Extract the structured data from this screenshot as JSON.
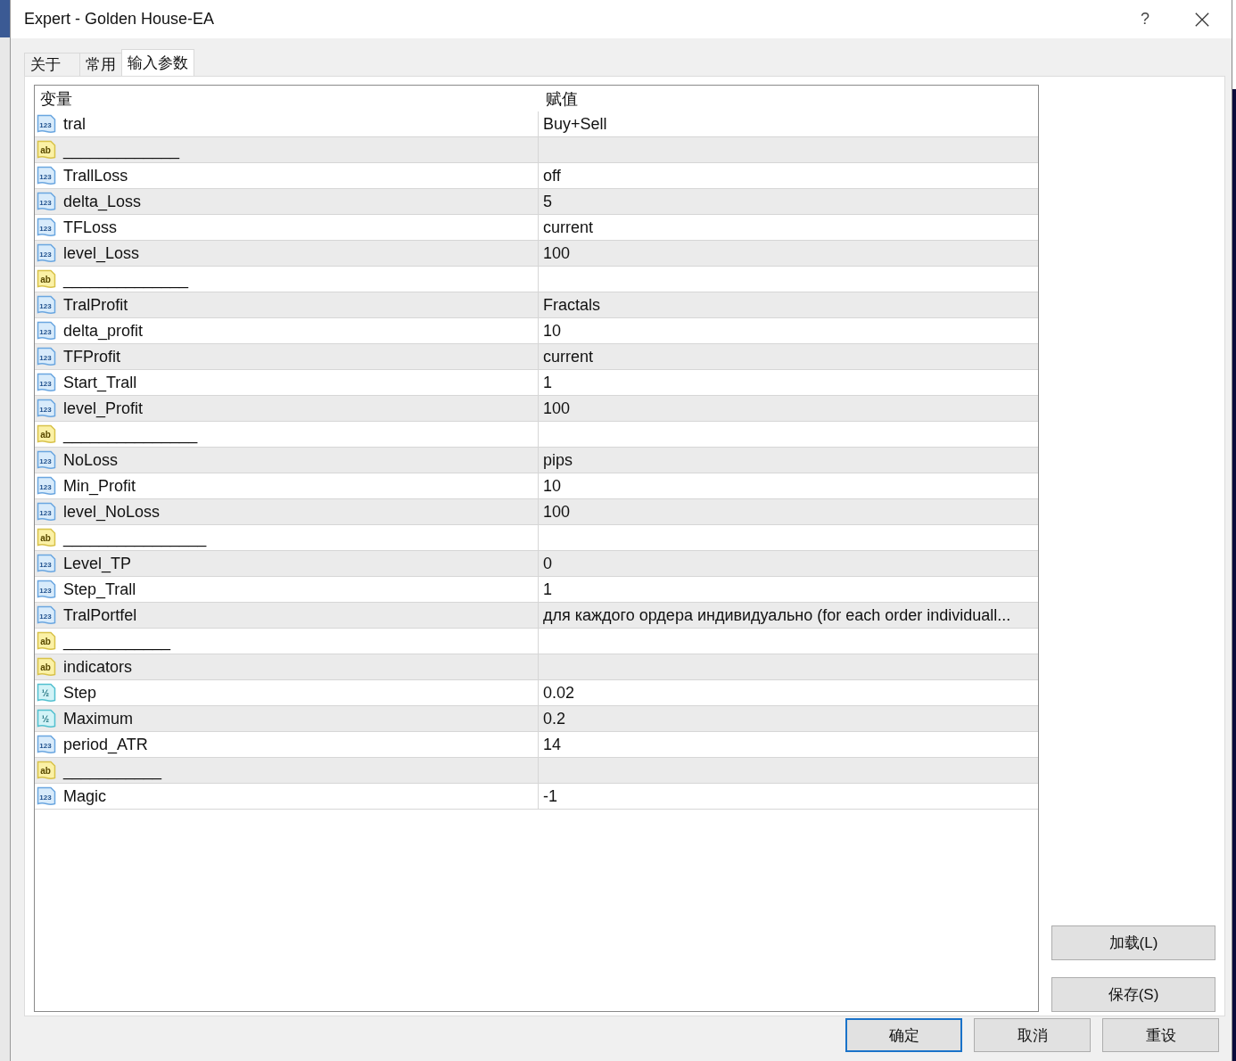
{
  "window": {
    "title": "Expert - Golden House-EA",
    "help_button": "?"
  },
  "tabs": [
    {
      "label": "关于",
      "selected": false
    },
    {
      "label": "常用",
      "selected": false
    },
    {
      "label": "输入参数",
      "selected": true
    }
  ],
  "table": {
    "columns": [
      "变量",
      "赋值"
    ],
    "rows": [
      {
        "kind": "int",
        "icon_label": "123",
        "name": "tral",
        "value": "Buy+Sell"
      },
      {
        "kind": "string",
        "icon_label": "ab",
        "name": "_____________",
        "value": ""
      },
      {
        "kind": "int",
        "icon_label": "123",
        "name": "TrallLoss",
        "value": "off"
      },
      {
        "kind": "int",
        "icon_label": "123",
        "name": "delta_Loss",
        "value": "5"
      },
      {
        "kind": "int",
        "icon_label": "123",
        "name": "TFLoss",
        "value": "current"
      },
      {
        "kind": "int",
        "icon_label": "123",
        "name": "level_Loss",
        "value": "100"
      },
      {
        "kind": "string",
        "icon_label": "ab",
        "name": "______________",
        "value": ""
      },
      {
        "kind": "int",
        "icon_label": "123",
        "name": "TralProfit",
        "value": "Fractals"
      },
      {
        "kind": "int",
        "icon_label": "123",
        "name": "delta_profit",
        "value": "10"
      },
      {
        "kind": "int",
        "icon_label": "123",
        "name": "TFProfit",
        "value": "current"
      },
      {
        "kind": "int",
        "icon_label": "123",
        "name": "Start_Trall",
        "value": "1"
      },
      {
        "kind": "int",
        "icon_label": "123",
        "name": "level_Profit",
        "value": "100"
      },
      {
        "kind": "string",
        "icon_label": "ab",
        "name": "_______________",
        "value": ""
      },
      {
        "kind": "int",
        "icon_label": "123",
        "name": "NoLoss",
        "value": "pips"
      },
      {
        "kind": "int",
        "icon_label": "123",
        "name": "Min_Profit",
        "value": "10"
      },
      {
        "kind": "int",
        "icon_label": "123",
        "name": "level_NoLoss",
        "value": "100"
      },
      {
        "kind": "string",
        "icon_label": "ab",
        "name": "________________",
        "value": ""
      },
      {
        "kind": "int",
        "icon_label": "123",
        "name": "Level_TP",
        "value": "0"
      },
      {
        "kind": "int",
        "icon_label": "123",
        "name": "Step_Trall",
        "value": "1"
      },
      {
        "kind": "int",
        "icon_label": "123",
        "name": "TralPortfel",
        "value": "для каждого ордера индивидуально (for each order individuall..."
      },
      {
        "kind": "string",
        "icon_label": "ab",
        "name": "____________",
        "value": ""
      },
      {
        "kind": "string",
        "icon_label": "ab",
        "name": "indicators",
        "value": ""
      },
      {
        "kind": "double",
        "icon_label": "½",
        "name": "Step",
        "value": "0.02"
      },
      {
        "kind": "double",
        "icon_label": "½",
        "name": "Maximum",
        "value": "0.2"
      },
      {
        "kind": "int",
        "icon_label": "123",
        "name": "period_ATR",
        "value": "14"
      },
      {
        "kind": "string",
        "icon_label": "ab",
        "name": "___________",
        "value": ""
      },
      {
        "kind": "int",
        "icon_label": "123",
        "name": "Magic",
        "value": "-1"
      }
    ]
  },
  "side_buttons": [
    "加载(L)",
    "保存(S)"
  ],
  "buttons": [
    {
      "label": "确定",
      "default": true
    },
    {
      "label": "取消",
      "default": false
    },
    {
      "label": "重设",
      "default": false
    }
  ]
}
